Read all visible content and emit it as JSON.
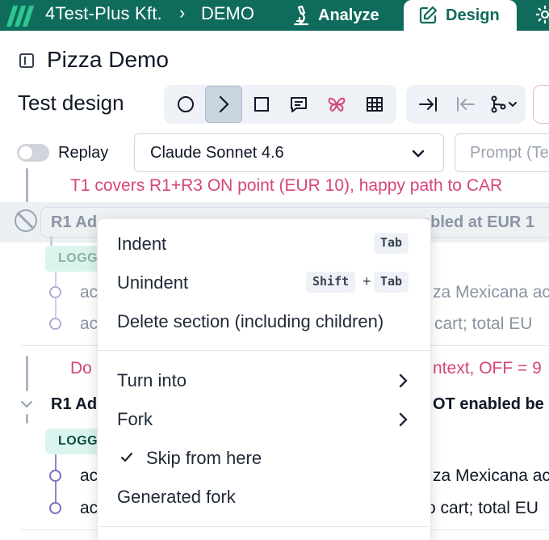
{
  "header": {
    "org": "4Test-Plus Kft.",
    "separator": "›",
    "project": "DEMO",
    "nav_analyze": "Analyze",
    "nav_design": "Design",
    "logo_icon": "brand-stripes-icon",
    "analyze_icon": "microscope-icon",
    "design_icon": "edit-square-icon",
    "settings_icon": "gear-icon",
    "brand_color": "#0f6b5c",
    "accent_color": "#2ec68f"
  },
  "page": {
    "title": "Pizza Demo",
    "section": "Test design"
  },
  "toolbar": {
    "tools": [
      "circle-icon",
      "chevron-right-icon",
      "square-icon",
      "comment-icon",
      "butterfly-icon",
      "table-icon",
      "indent-icon",
      "outdent-icon",
      "fork-icon"
    ],
    "active_tool": "chevron-right-icon"
  },
  "replay": {
    "label": "Replay",
    "enabled": false
  },
  "model": {
    "selected": "Claude Sonnet 4.6"
  },
  "prompt": {
    "placeholder": "Prompt (Te"
  },
  "tree": {
    "test1_text": "T1 covers R1+R3 ON point (EUR 10), happy path to CAR",
    "row1_left": "R1 Ad",
    "row1_right": "abled at EUR 1",
    "row1_badge": "LOGG",
    "row1_step1_left": "ac",
    "row1_step1_right": "za Mexicana ac",
    "row1_step2_left": "ac",
    "row1_step2_right": "cart; total EU",
    "test2_left": "Do",
    "test2_right": "ntext, OFF = 9",
    "row2_left": "R1 Ad",
    "row2_right": "OT enabled be",
    "row2_badge": "LOGG",
    "row2_step1_left": "ac",
    "row2_step1_right": "za Mexicana ac",
    "row2_step2_left": "ac",
    "row2_step2_right": "o cart; total EU",
    "pink_color": "#d6457c"
  },
  "context_menu": {
    "indent": "Indent",
    "indent_key": "Tab",
    "unindent": "Unindent",
    "unindent_key1": "Shift",
    "unindent_plus": "+",
    "unindent_key2": "Tab",
    "delete_section": "Delete section (including children)",
    "turn_into": "Turn into",
    "fork": "Fork",
    "skip_from_here": "Skip from here",
    "skip_checked": true,
    "generated_fork": "Generated fork"
  }
}
